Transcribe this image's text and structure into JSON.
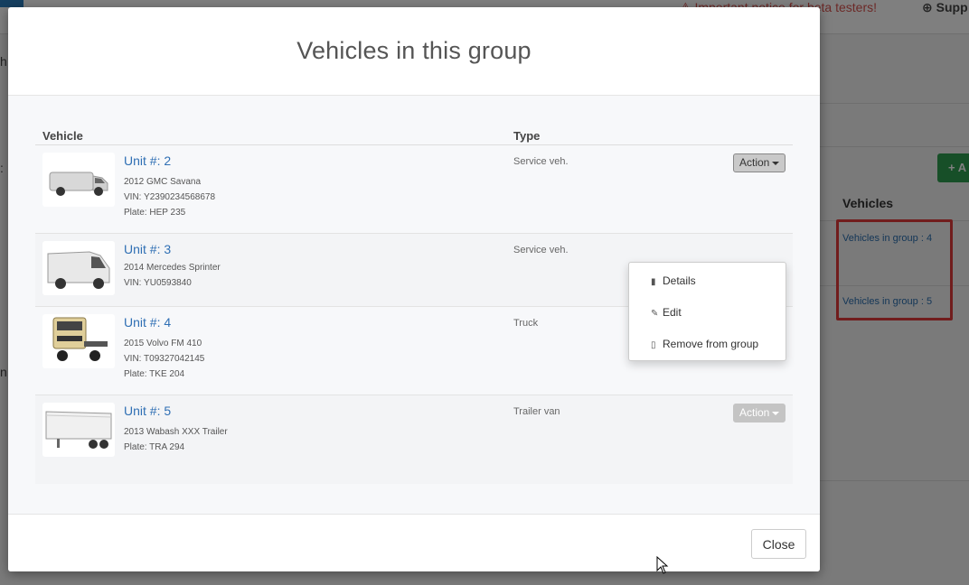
{
  "background": {
    "notice": "Important notice for beta testers!",
    "support": "Supp",
    "add_button": "+ A",
    "table_header": "Vehicles",
    "groups": [
      {
        "link": "Vehicles in group : 4"
      },
      {
        "link": "Vehicles in group : 5"
      }
    ],
    "left_fragments": [
      "h",
      ":",
      "n"
    ]
  },
  "modal": {
    "title": "Vehicles in this group",
    "columns": {
      "vehicle": "Vehicle",
      "type": "Type"
    },
    "action_label": "Action",
    "rows": [
      {
        "unit": "Unit #: 2",
        "model": "2012 GMC Savana",
        "vin": "VIN: Y2390234568678",
        "plate": "Plate: HEP 235",
        "type": "Service veh."
      },
      {
        "unit": "Unit #: 3",
        "model": "2014 Mercedes Sprinter",
        "vin": "VIN: YU0593840",
        "plate": "",
        "type": "Service veh."
      },
      {
        "unit": "Unit #: 4",
        "model": "2015 Volvo FM 410",
        "vin": "VIN: T09327042145",
        "plate": "Plate: TKE 204",
        "type": "Truck"
      },
      {
        "unit": "Unit #: 5",
        "model": "2013 Wabash XXX Trailer",
        "vin": "",
        "plate": "Plate: TRA 294",
        "type": "Trailer van"
      }
    ],
    "dropdown": {
      "items": [
        {
          "label": "Details",
          "icon": "book-icon"
        },
        {
          "label": "Edit",
          "icon": "edit-icon"
        },
        {
          "label": "Remove from group",
          "icon": "trash-icon"
        }
      ]
    },
    "close_label": "Close"
  },
  "colors": {
    "link": "#2f6fb4",
    "highlight": "#e23b3b",
    "notice": "#d9534f",
    "add_button": "#2e9e50"
  }
}
